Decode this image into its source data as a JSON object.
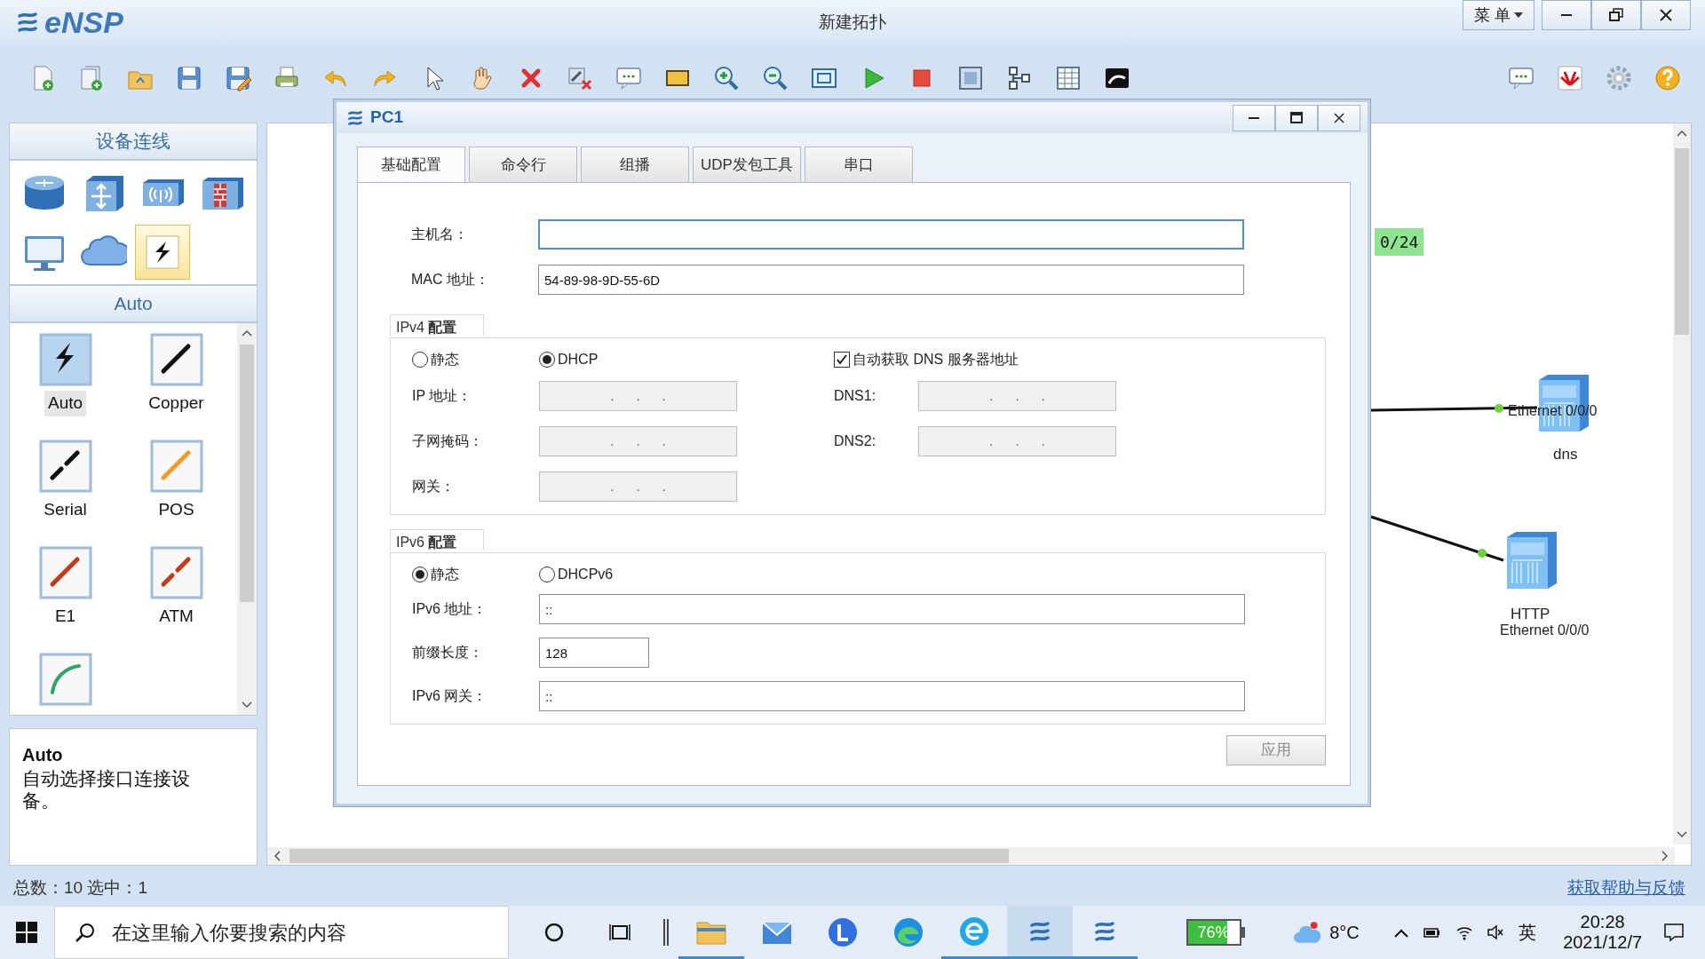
{
  "app": {
    "logo": "eNSP",
    "title": "新建拓扑",
    "menu": "菜 单"
  },
  "device_panel": {
    "title": "设备连线",
    "devices": [
      {
        "kind": "router",
        "selected": false
      },
      {
        "kind": "switch",
        "selected": false
      },
      {
        "kind": "wireless",
        "selected": false
      },
      {
        "kind": "firewall",
        "selected": false
      },
      {
        "kind": "pc",
        "selected": false
      },
      {
        "kind": "cloud",
        "selected": false
      },
      {
        "kind": "link",
        "selected": true
      }
    ]
  },
  "link_panel": {
    "title": "Auto",
    "links": [
      {
        "kind": "auto",
        "label": "Auto",
        "selected": true
      },
      {
        "kind": "copper",
        "label": "Copper",
        "selected": false
      },
      {
        "kind": "serial",
        "label": "Serial",
        "selected": false
      },
      {
        "kind": "pos",
        "label": "POS",
        "selected": false
      },
      {
        "kind": "e1",
        "label": "E1",
        "selected": false
      },
      {
        "kind": "atm",
        "label": "ATM",
        "selected": false
      },
      {
        "kind": "curve",
        "selected": false
      }
    ]
  },
  "description": {
    "title": "Auto",
    "text": "自动选择接口连接设备。"
  },
  "canvas": {
    "subnet_tag": "0/24",
    "nodes": [
      {
        "name": "dns",
        "port": "Ethernet 0/0/0"
      },
      {
        "name": "HTTP",
        "port": "Ethernet 0/0/0"
      }
    ]
  },
  "dialog": {
    "title": "PC1",
    "tabs": [
      {
        "label": "基础配置",
        "selected": true
      },
      {
        "label": "命令行",
        "selected": false
      },
      {
        "label": "组播",
        "selected": false
      },
      {
        "label": "UDP发包工具",
        "selected": false
      },
      {
        "label": "串口",
        "selected": false
      }
    ],
    "hostname": {
      "label": "主机名：",
      "focused": true
    },
    "mac": {
      "label": "MAC 地址：",
      "value": "54-89-98-9D-55-6D"
    },
    "ipv4": {
      "title": "IPv4 **配置**",
      "modes": [
        {
          "label": "静态",
          "selected": false
        },
        {
          "label": "DHCP",
          "selected": true
        }
      ],
      "auto_dns": {
        "label": "自动获取 DNS 服务器地址",
        "checked": true
      },
      "fields": [
        {
          "label": "IP 地址：",
          "value": ".      .      .",
          "disabled": true
        },
        {
          "label": "子网掩码：",
          "value": ".      .      .",
          "disabled": true
        },
        {
          "label": "网关：",
          "value": ".      .      .",
          "disabled": true
        }
      ],
      "dns": [
        {
          "label": "DNS1:",
          "value": ".      .      .",
          "disabled": true
        },
        {
          "label": "DNS2:",
          "value": ".      .      .",
          "disabled": true
        }
      ]
    },
    "ipv6": {
      "title": "IPv6 **配置**",
      "modes": [
        {
          "label": "静态",
          "selected": true
        },
        {
          "label": "DHCPv6",
          "selected": false
        }
      ],
      "fields": [
        {
          "label": "IPv6 地址：",
          "value": "::",
          "kind": "wide"
        },
        {
          "label": "前缀长度：",
          "value": "128",
          "kind": "short"
        },
        {
          "label": "IPv6 网关：",
          "value": "::",
          "kind": "wide"
        }
      ]
    },
    "apply": {
      "label": "应用",
      "disabled": true
    }
  },
  "status_bar": {
    "counts": "总数：10  选中：1",
    "help_link": "获取帮助与反馈"
  },
  "taskbar": {
    "search_placeholder": "在这里输入你要搜索的内容",
    "apps": [
      {
        "kind": "explorer",
        "running": true,
        "selected": false
      },
      {
        "kind": "mail",
        "running": false,
        "selected": false
      },
      {
        "kind": "launcher",
        "running": false,
        "selected": false
      },
      {
        "kind": "edge",
        "running": false,
        "selected": false
      },
      {
        "kind": "ie",
        "running": true,
        "selected": false
      },
      {
        "kind": "ensp",
        "running": true,
        "selected": true
      },
      {
        "kind": "ensp",
        "running": true,
        "selected": false
      }
    ],
    "battery": {
      "text": "76%",
      "level": 0.76
    },
    "weather": "8°C",
    "ime": "英",
    "time": "20:28",
    "date": "2021/12/7"
  }
}
